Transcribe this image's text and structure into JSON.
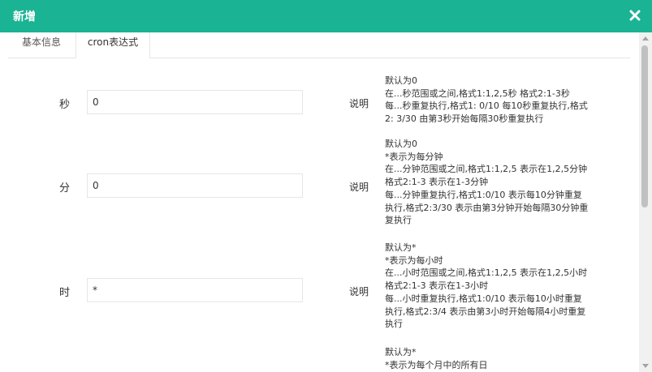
{
  "dialog": {
    "title": "新增",
    "close_icon": "close-icon"
  },
  "tabs": [
    {
      "label": "基本信息"
    },
    {
      "label": "cron表达式"
    }
  ],
  "rows": [
    {
      "label": "秒",
      "value": "0",
      "desc_label": "说明",
      "desc_lines": [
        "默认为0",
        "在...秒范围或之间,格式1:1,2,5秒 格式2:1-3秒",
        "每...秒重复执行,格式1: 0/10 每10秒重复执行,格式",
        "2: 3/30 由第3秒开始每隔30秒重复执行"
      ]
    },
    {
      "label": "分",
      "value": "0",
      "desc_label": "说明",
      "desc_lines": [
        "默认为0",
        "*表示为每分钟",
        "在...分钟范围或之间,格式1:1,2,5 表示在1,2,5分钟",
        "格式2:1-3 表示在1-3分钟",
        "每...分钟重复执行,格式1:0/10 表示每10分钟重复",
        "执行,格式2:3/30 表示由第3分钟开始每隔30分钟重",
        "复执行"
      ]
    },
    {
      "label": "时",
      "value": "*",
      "desc_label": "说明",
      "desc_lines": [
        "默认为*",
        "*表示为每小时",
        "在...小时范围或之间,格式1:1,2,5 表示在1,2,5小时",
        "格式2:1-3 表示在1-3小时",
        "每...小时重复执行,格式1:0/10 表示每10小时重复",
        "执行,格式2:3/4 表示由第3小时开始每隔4小时重复",
        "执行"
      ]
    },
    {
      "desc_lines": [
        "默认为*",
        "*表示为每个月中的所有日"
      ]
    }
  ]
}
